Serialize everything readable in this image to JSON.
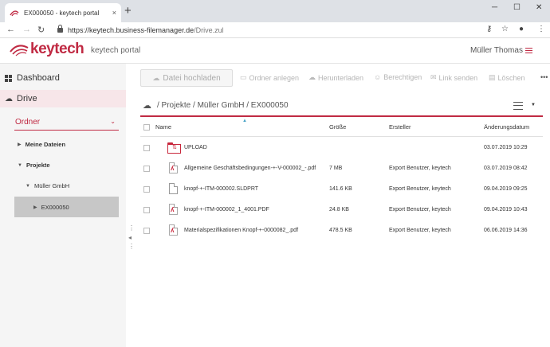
{
  "browser": {
    "tab_title": "EX000050 - keytech portal",
    "tab_close": "×",
    "new_tab": "+",
    "url_host": "https://keytech.business-filemanager.de",
    "url_path": "/Drive.zul",
    "win_minimize": "─",
    "win_maximize": "☐",
    "win_close": "✕"
  },
  "header": {
    "logo": "keytech",
    "portal": "keytech portal",
    "user": "Müller Thomas"
  },
  "sidebar": {
    "dashboard": "Dashboard",
    "drive": "Drive",
    "select_value": "Ordner",
    "tree": [
      {
        "label": "Meine Dateien"
      },
      {
        "label": "Projekte"
      },
      {
        "label": "Müller GmbH"
      },
      {
        "label": "EX000050"
      }
    ]
  },
  "actions": {
    "upload": "Datei hochladen",
    "new_folder": "Ordner anlegen",
    "download": "Herunterladen",
    "permissions": "Berechtigen",
    "send_link": "Link senden",
    "delete": "Löschen"
  },
  "breadcrumb": "/ Projekte / Müller GmbH / EX000050",
  "table": {
    "headers": {
      "name": "Name",
      "size": "Größe",
      "creator": "Ersteller",
      "modified": "Änderungsdatum"
    },
    "rows": [
      {
        "type": "folder",
        "name": "UPLOAD",
        "size": "",
        "creator": "",
        "modified": "03.07.2019 10:29"
      },
      {
        "type": "pdf",
        "name": "Allgemeine Geschäftsbedingungen-+-V-000002_-.pdf",
        "size": "7 MB",
        "creator": "Export Benutzer, keytech",
        "modified": "03.07.2019 08:42"
      },
      {
        "type": "file",
        "name": "knopf-+-ITM-000002.SLDPRT",
        "size": "141.6 KB",
        "creator": "Export Benutzer, keytech",
        "modified": "09.04.2019 09:25"
      },
      {
        "type": "pdf",
        "name": "knopf-+-ITM-000002_1_4001.PDF",
        "size": "24.8 KB",
        "creator": "Export Benutzer, keytech",
        "modified": "09.04.2019 10:43"
      },
      {
        "type": "pdf",
        "name": "Materialspezifikationen Knopf-+-0000082_.pdf",
        "size": "478.5 KB",
        "creator": "Export Benutzer, keytech",
        "modified": "06.06.2019 14:36"
      }
    ]
  },
  "colors": {
    "brand": "#c02a43",
    "sort_indicator": "#4aa4c8"
  }
}
